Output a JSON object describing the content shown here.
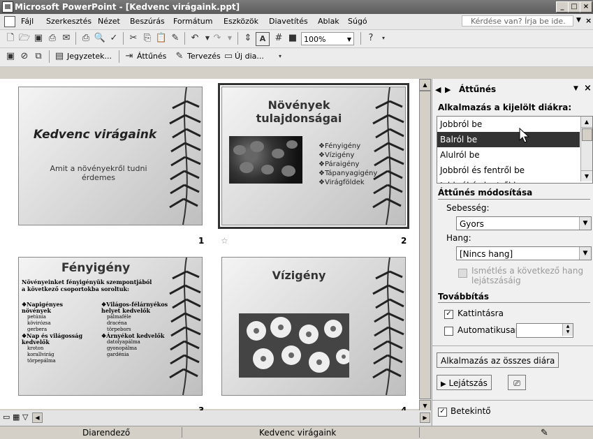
{
  "window": {
    "title": "Microsoft PowerPoint - [Kedvenc virágaink.ppt]"
  },
  "menu": {
    "items": [
      "Fájl",
      "Szerkesztés",
      "Nézet",
      "Beszúrás",
      "Formátum",
      "Eszközök",
      "Diavetítés",
      "Ablak",
      "Súgó"
    ],
    "help_placeholder": "Kérdése van? Írja be ide."
  },
  "toolbar": {
    "zoom": "100%"
  },
  "toolbar2": {
    "notes": "Jegyzetek...",
    "transition": "Áttűnés",
    "design": "Tervezés",
    "new_slide": "Új dia..."
  },
  "slides": [
    {
      "num": "1",
      "title": "Kedvenc virágaink",
      "subtitle_line1": "Amit a növényekről tudni",
      "subtitle_line2": "érdemes"
    },
    {
      "num": "2",
      "title_line1": "Növények",
      "title_line2": "tulajdonságai",
      "bullets": [
        "❖Fényigény",
        "❖Vízigény",
        "❖Páraigény",
        "❖Tápanyagigény",
        "❖Virágföldek"
      ]
    },
    {
      "num": "3",
      "title": "Fényigény",
      "intro_line1": "Növényeinket fényigényük szempontjából",
      "intro_line2": "a következő csoportokba soroltuk:",
      "col1_head": "❖Napigényes növények",
      "col1_items": [
        "petúnia",
        "kövirózsa",
        "gerbera"
      ],
      "col1_head2": "❖Nap és világosság kedvelők",
      "col1_items2": [
        "kroton",
        "korallvirág",
        "törpepálma"
      ],
      "col2_head": "❖Világos-félárnyékos helyet kedvelők",
      "col2_items": [
        "pálmaféle",
        "dracéna",
        "törpebors"
      ],
      "col2_head2": "❖Árnyékot kedvelők",
      "col2_items2": [
        "datolyapálma",
        "gyonopálma",
        "gardénia"
      ]
    },
    {
      "num": "4",
      "title": "Vízigény"
    }
  ],
  "pane": {
    "title": "Áttűnés",
    "apply_label": "Alkalmazás a kijelölt diákra:",
    "list": [
      "Jobbról be",
      "Balról be",
      "Alulról be",
      "Jobbról és fentről be",
      "Jobbról és lentről be"
    ],
    "selected_index": 1,
    "modify_label": "Áttűnés módosítása",
    "speed_label": "Sebesség:",
    "speed_value": "Gyors",
    "sound_label": "Hang:",
    "sound_value": "[Nincs hang]",
    "loop_line1": "Ismétlés a következő hang",
    "loop_line2": "lejátszásáig",
    "advance_label": "Továbbítás",
    "on_click": "Kattintásra",
    "automatic": "Automatikusan",
    "apply_all": "Alkalmazás az összes diára",
    "play": "Lejátszás",
    "preview": "Betekintő"
  },
  "status": {
    "view": "Diarendező",
    "design": "Kedvenc virágaink"
  }
}
